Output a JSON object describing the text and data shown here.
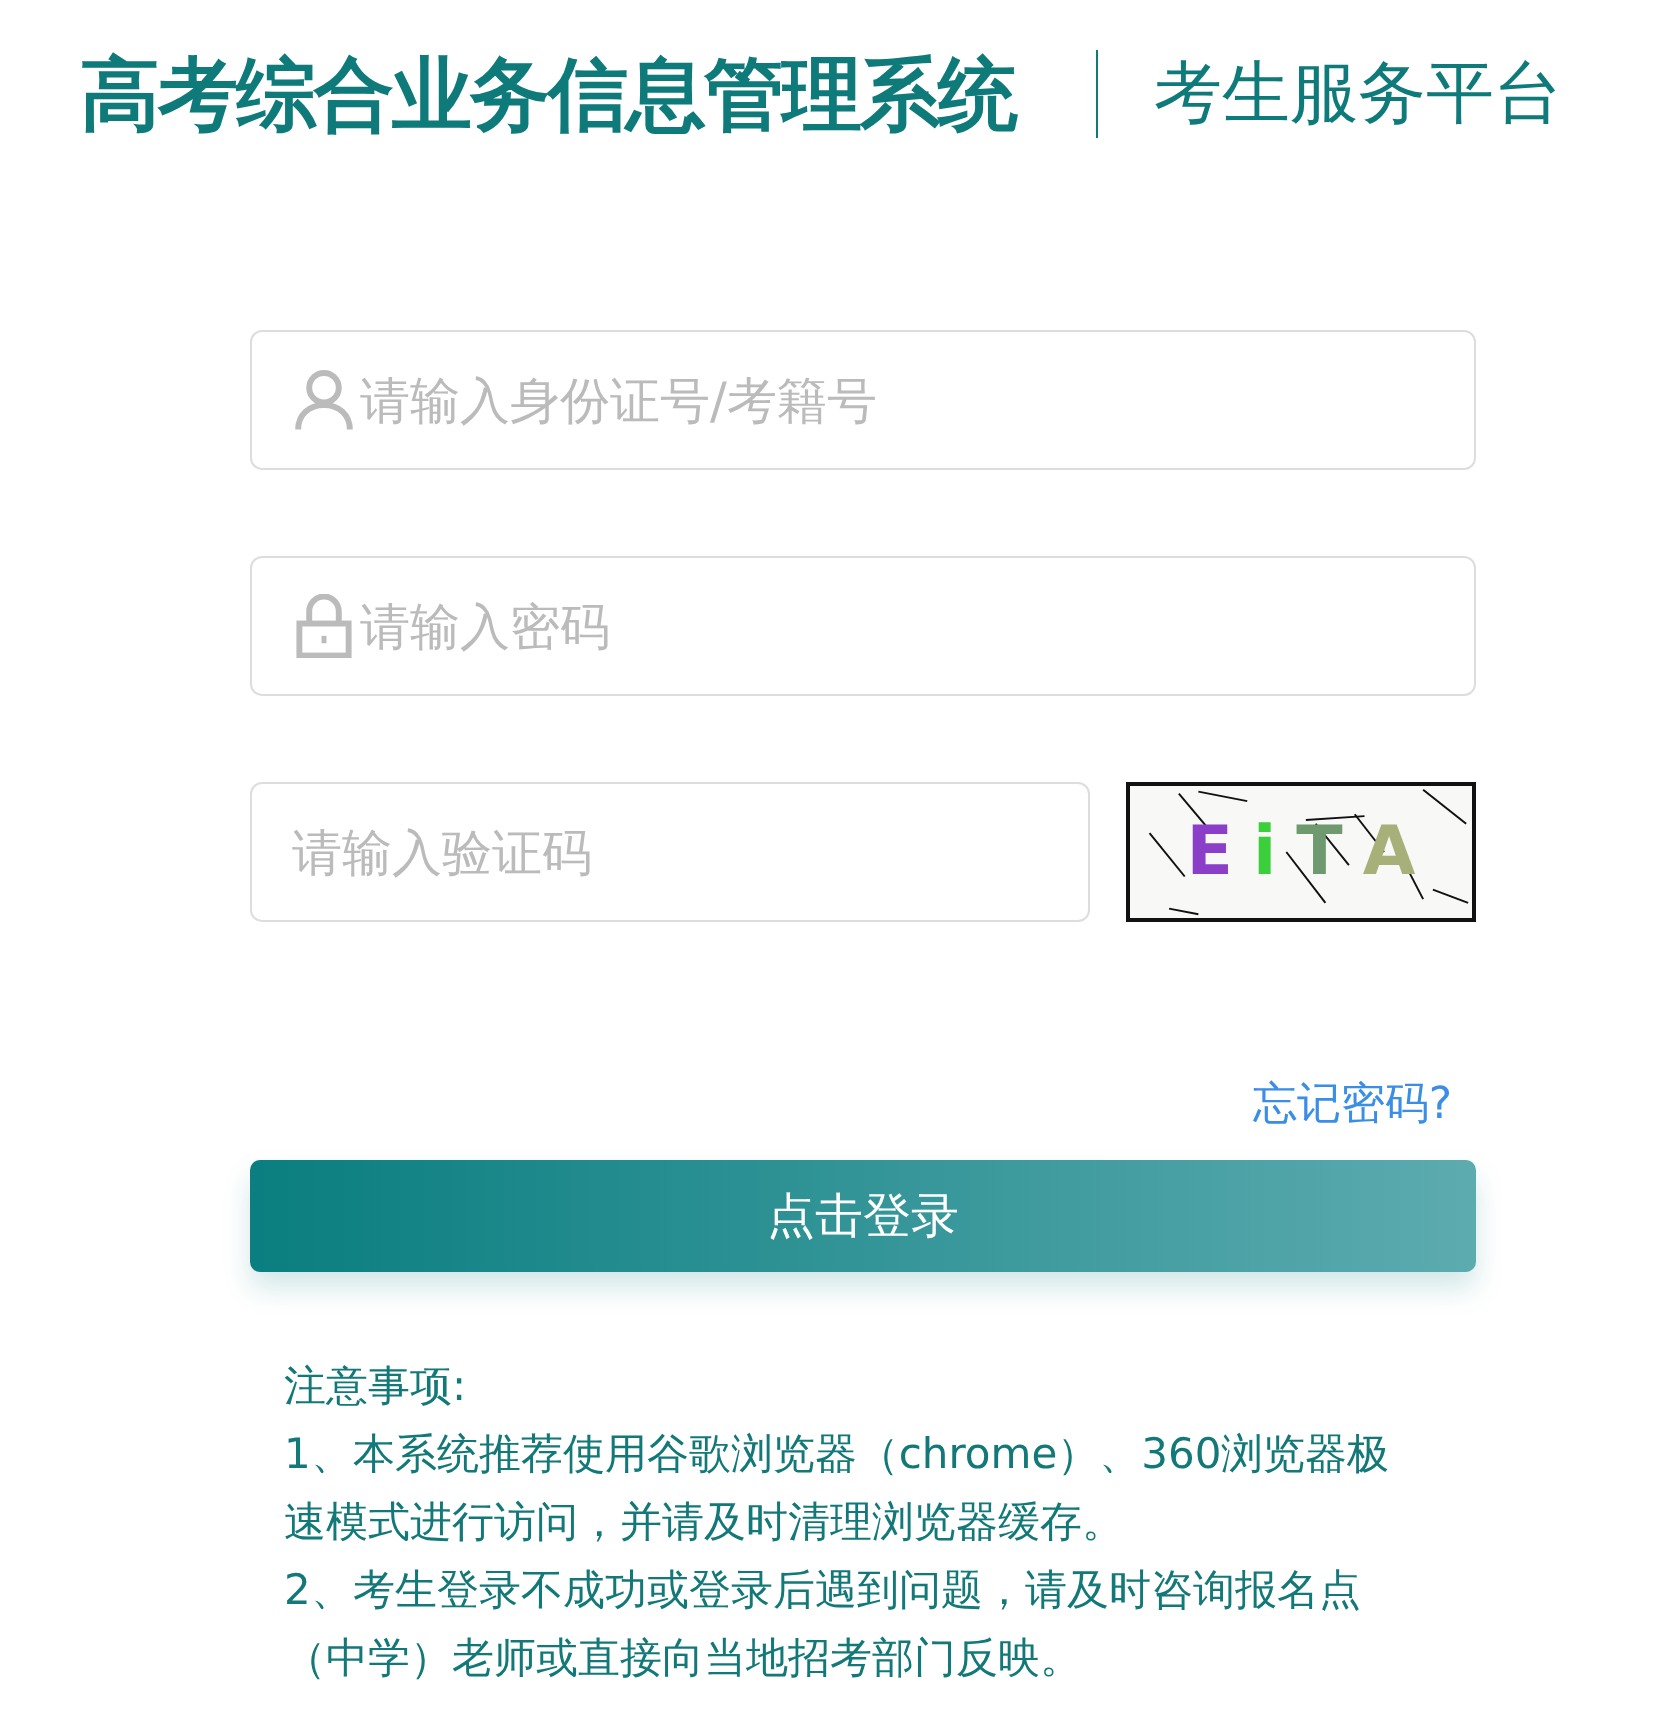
{
  "header": {
    "title": "高考综合业务信息管理系统",
    "subtitle": "考生服务平台"
  },
  "fields": [
    {
      "kind": "user",
      "placeholder": "请输入身份证号/考籍号"
    },
    {
      "kind": "password",
      "placeholder": "请输入密码"
    },
    {
      "kind": "captcha",
      "placeholder": "请输入验证码"
    }
  ],
  "captcha": {
    "characters": [
      {
        "char": "E",
        "color": "#8b3fc8"
      },
      {
        "char": "i",
        "color": "#3ccf3c"
      },
      {
        "char": "T",
        "color": "#6f9a6f"
      },
      {
        "char": "A",
        "color": "#a8b07a"
      }
    ]
  },
  "forgot_link": "忘记密码?",
  "login_button": "点击登录",
  "notes": {
    "title": "注意事项:",
    "items": [
      "1、本系统推荐使用谷歌浏览器（chrome）、360浏览器极速模式进行访问，并请及时清理浏览器缓存。",
      "2、考生登录不成功或登录后遇到问题，请及时咨询报名点（中学）老师或直接向当地招考部门反映。"
    ]
  }
}
